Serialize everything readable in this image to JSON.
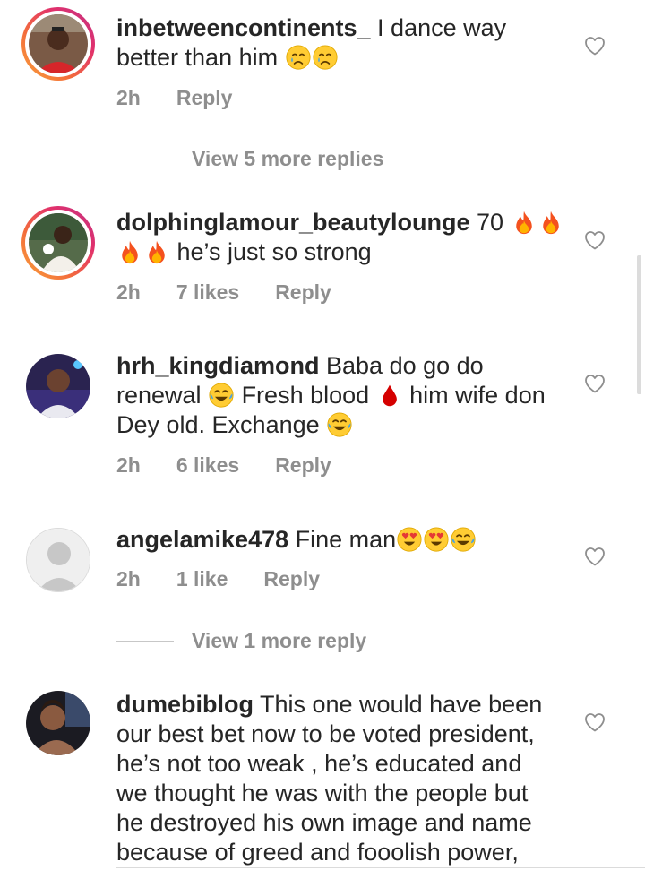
{
  "comments": [
    {
      "username": "inbetweencontinents_",
      "text": " I dance way better than him",
      "emojis": [
        "crying-face",
        "crying-face"
      ],
      "time": "2h",
      "likes": "",
      "reply": "Reply",
      "story_ring": true
    },
    {
      "username": "dolphinglamour_beautylounge",
      "text": " 70",
      "emojis": [
        "fire",
        "fire",
        "fire",
        "fire"
      ],
      "text2": " he’s just so strong",
      "time": "2h",
      "likes": "7 likes",
      "reply": "Reply",
      "story_ring": true
    },
    {
      "username": "hrh_kingdiamond",
      "text_a": " Baba do go do renewal ",
      "text_b": " Fresh blood ",
      "text_c": " him wife don Dey old. Exchange ",
      "emojis": [
        "tears-of-joy",
        "blood-drop",
        "tears-of-joy"
      ],
      "time": "2h",
      "likes": "6 likes",
      "reply": "Reply",
      "story_ring": false
    },
    {
      "username": "angelamike478",
      "text": " Fine man",
      "emojis": [
        "heart-eyes",
        "heart-eyes",
        "tears-of-joy"
      ],
      "time": "2h",
      "likes": "1 like",
      "reply": "Reply",
      "story_ring": false
    },
    {
      "username": "dumebiblog",
      "text": " This one would have been our best bet now to be voted president, he’s not too weak , he’s educated and we thought he was with the people but he destroyed his own image and name because of greed and fooolish power,",
      "story_ring": false
    }
  ],
  "view_more": [
    {
      "label": "View 5 more replies"
    },
    {
      "label": "View 1 more reply"
    }
  ],
  "colors": {
    "text": "#262626",
    "secondary": "#8e8e8e",
    "story_ring_start": "#f9a23a",
    "story_ring_end": "#c13584"
  }
}
